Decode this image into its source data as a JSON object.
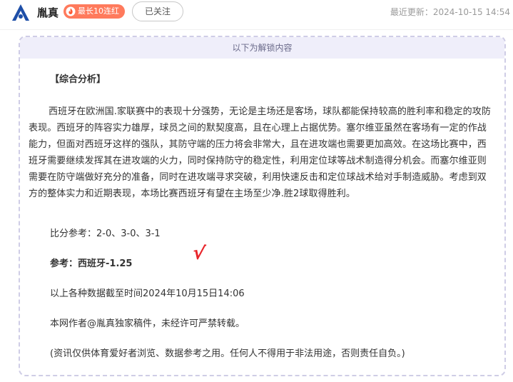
{
  "header": {
    "avatar_text": "胤真",
    "author_name": "胤真",
    "streak_badge": "最长10连红",
    "follow_label": "已关注",
    "last_update": "最近更新：2024-10-15 14:54"
  },
  "unlock": {
    "banner": "以下为解锁内容",
    "section_title": "【综合分析】",
    "analysis": "西班牙在欧洲国.家联赛中的表现十分强势，无论是主场还是客场，球队都能保持较高的胜利率和稳定的攻防表现。西班牙的阵容实力雄厚，球员之间的默契度高，且在心理上占据优势。塞尔维亚虽然在客场有一定的作战能力，但面对西班牙这样的强队，其防守端的压力将会非常大，且在进攻端也需要更加高效。在这场比赛中，西班牙需要继续发挥其在进攻端的火力，同时保持防守的稳定性，利用定位球等战术制造得分机会。而塞尔维亚则需要在防守端做好充分的准备，同时在进攻端寻求突破，利用快速反击和定位球战术给对手制造威胁。考虑到双方的整体实力和近期表现，本场比赛西班牙有望在主场至少净.胜2球取得胜利。",
    "score_ref": "比分参考：2-0、3-0、3-1",
    "tip_ref": "参考：西班牙-1.25",
    "check_mark": "√",
    "data_cutoff": "以上各种数据截至时间2024年10月15日14:06",
    "copyright": "本网作者@胤真独家稿件，未经许可严禁转载。",
    "disclaimer": "(资讯仅供体育爱好者浏览、数据参考之用。任何人不得用于非法用途，否则责任自负。)"
  },
  "colors": {
    "badge": "#ff7a5c",
    "check": "#e8242a",
    "border": "#cfcde6",
    "banner_bg": "#efeefa"
  }
}
